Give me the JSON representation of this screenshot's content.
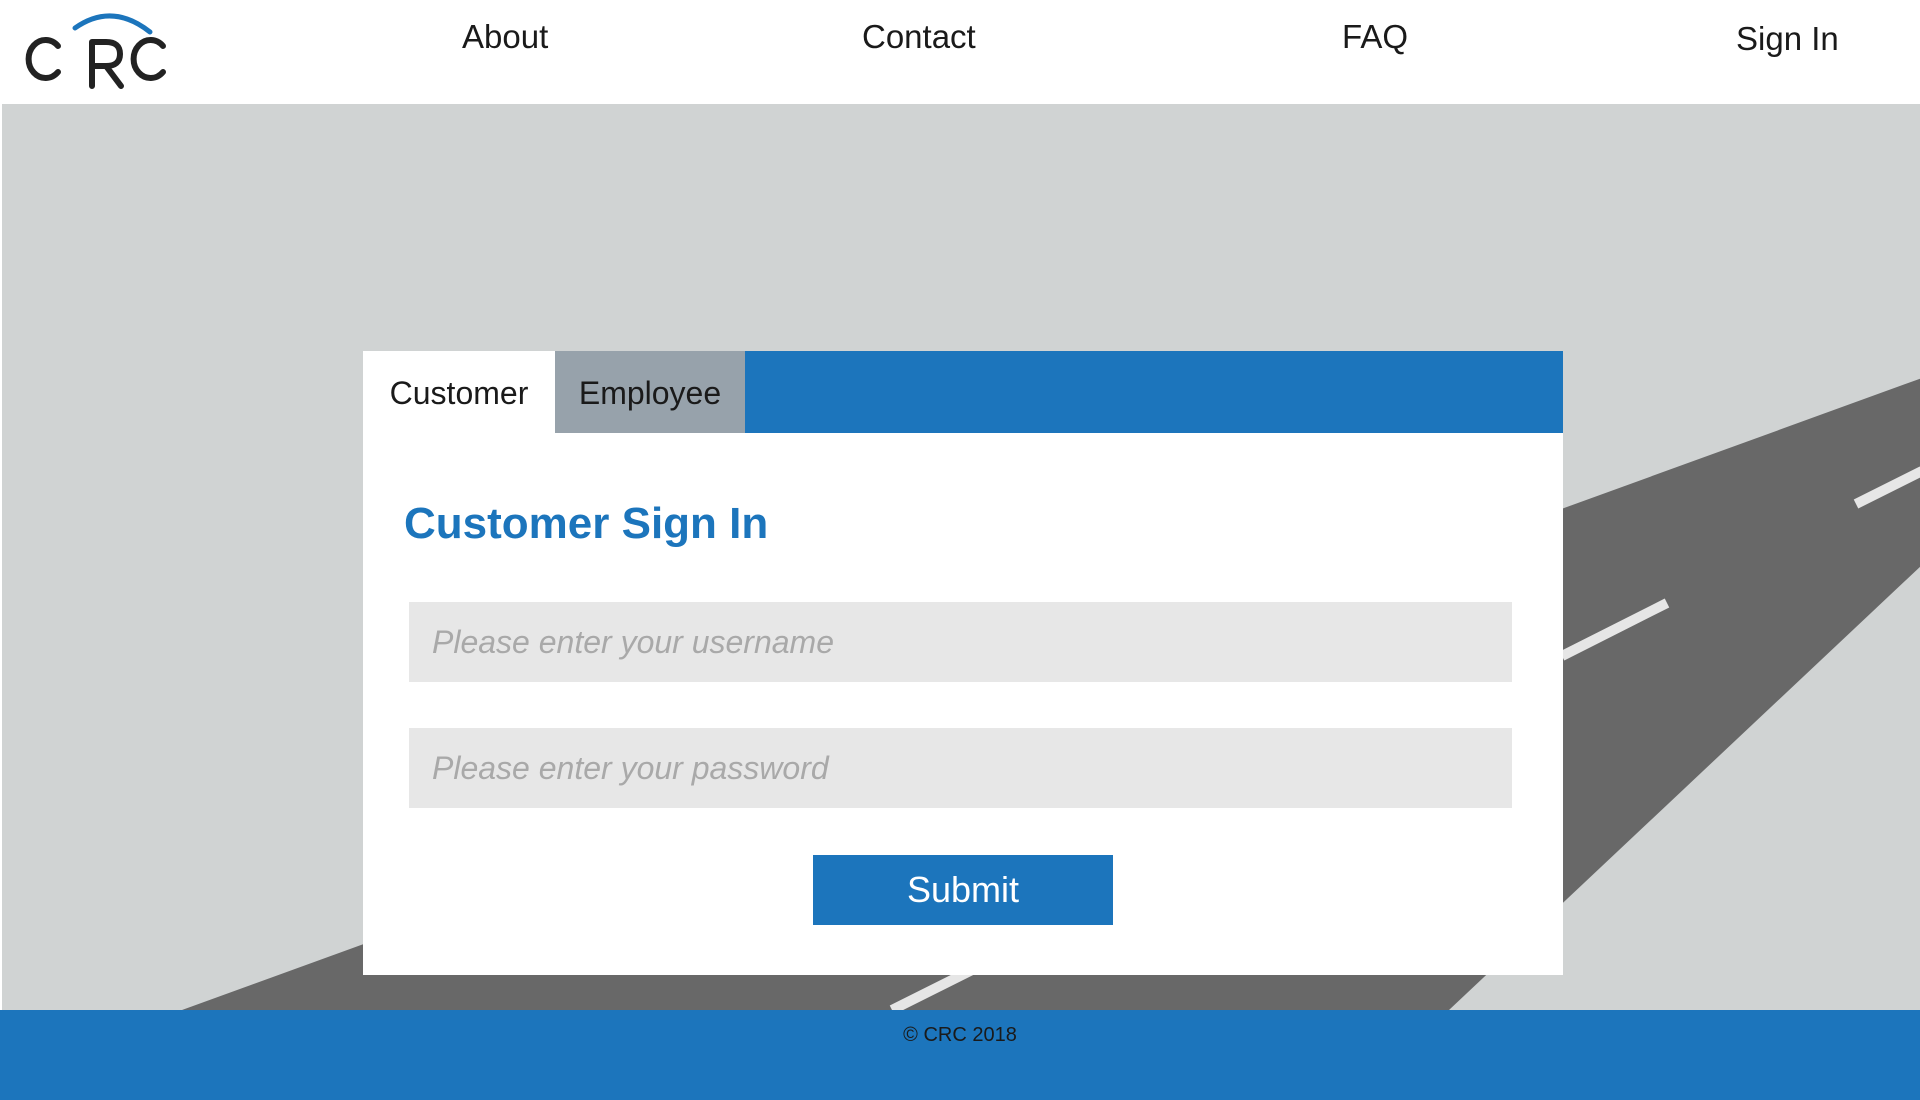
{
  "brand": {
    "logo_text": "CRC",
    "accent_color": "#1c75bc"
  },
  "nav": {
    "items": [
      {
        "label": "About"
      },
      {
        "label": "Contact"
      },
      {
        "label": "FAQ"
      },
      {
        "label": "Sign In"
      }
    ]
  },
  "signin": {
    "tabs": [
      {
        "label": "Customer",
        "active": true
      },
      {
        "label": "Employee",
        "active": false
      }
    ],
    "title": "Customer Sign In",
    "username": {
      "value": "",
      "placeholder": "Please enter your username"
    },
    "password": {
      "value": "",
      "placeholder": "Please enter your password"
    },
    "submit_label": "Submit"
  },
  "footer": {
    "copyright": "© CRC 2018"
  },
  "colors": {
    "primary": "#1c75bc",
    "background": "#d0d3d3",
    "road": "#686868",
    "tab_inactive": "#97a2ab",
    "field_bg": "#e7e7e7"
  }
}
